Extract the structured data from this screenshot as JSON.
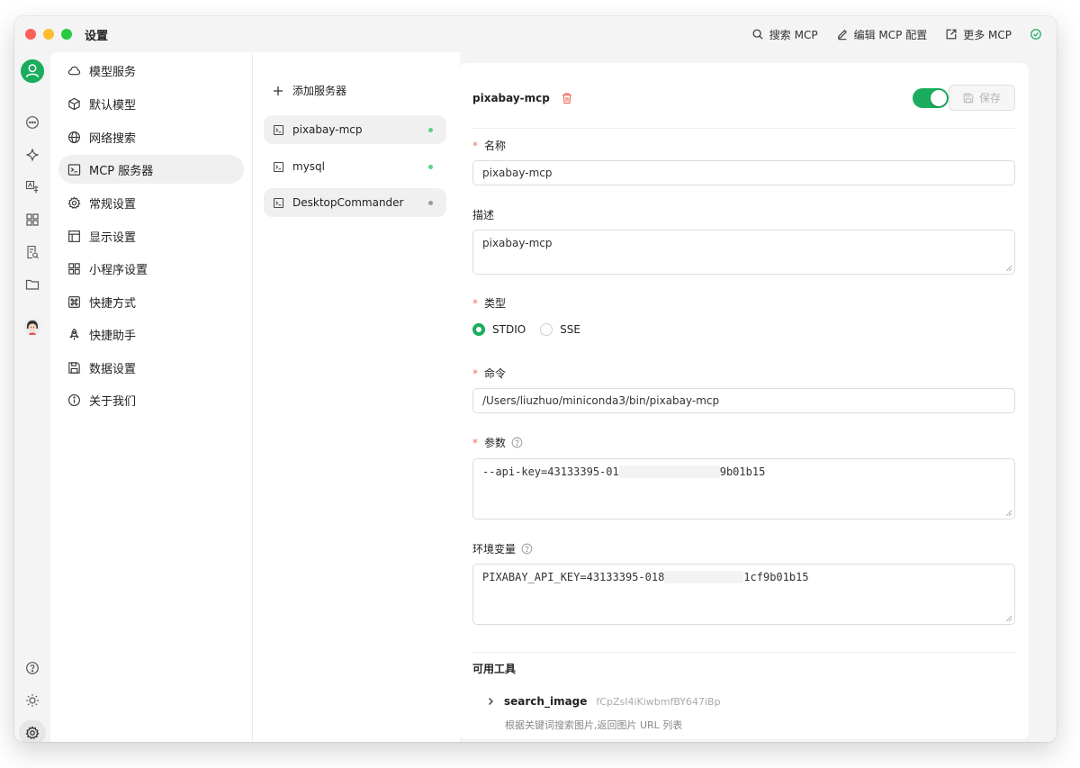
{
  "window": {
    "title": "设置"
  },
  "titlebar": {
    "actions": [
      {
        "label": "搜索 MCP",
        "icon": "search-icon"
      },
      {
        "label": "编辑 MCP 配置",
        "icon": "edit-icon"
      },
      {
        "label": "更多 MCP",
        "icon": "external-link-icon"
      }
    ]
  },
  "colors": {
    "accent": "#1aad5e",
    "danger": "#f07060",
    "traffic_red": "#fe5f57",
    "traffic_yellow": "#febc2e",
    "traffic_green": "#28c840",
    "status_active": "#5fcf8a",
    "status_inactive": "#9a9a9e"
  },
  "menu": {
    "items": [
      {
        "label": "模型服务",
        "icon": "cloud-icon"
      },
      {
        "label": "默认模型",
        "icon": "cube-icon"
      },
      {
        "label": "网络搜索",
        "icon": "globe-icon"
      },
      {
        "label": "MCP 服务器",
        "icon": "terminal-icon"
      },
      {
        "label": "常规设置",
        "icon": "gear-icon"
      },
      {
        "label": "显示设置",
        "icon": "layout-icon"
      },
      {
        "label": "小程序设置",
        "icon": "grid-icon"
      },
      {
        "label": "快捷方式",
        "icon": "command-icon"
      },
      {
        "label": "快捷助手",
        "icon": "rocket-icon"
      },
      {
        "label": "数据设置",
        "icon": "save-icon"
      },
      {
        "label": "关于我们",
        "icon": "info-icon"
      }
    ],
    "active_index": 3
  },
  "servers": {
    "add_label": "添加服务器",
    "items": [
      {
        "name": "pixabay-mcp",
        "active": true
      },
      {
        "name": "mysql",
        "active": true
      },
      {
        "name": "DesktopCommander",
        "active": false
      }
    ]
  },
  "detail": {
    "name": "pixabay-mcp",
    "enabled": true,
    "save_label": "保存",
    "fields": {
      "name_label": "名称",
      "name_value": "pixabay-mcp",
      "desc_label": "描述",
      "desc_value": "pixabay-mcp",
      "type_label": "类型",
      "type_options": [
        "STDIO",
        "SSE"
      ],
      "type_selected": "STDIO",
      "command_label": "命令",
      "command_value": "/Users/liuzhuo/miniconda3/bin/pixabay-mcp",
      "args_label": "参数",
      "args_prefix": "--api-key=43133395-01",
      "args_suffix": "9b01b15",
      "env_label": "环境变量",
      "env_prefix": "PIXABAY_API_KEY=43133395-018",
      "env_suffix": "1cf9b01b15"
    },
    "tools": {
      "title": "可用工具",
      "items": [
        {
          "name": "search_image",
          "id": "fCpZsI4iKiwbmfBY647iBp",
          "description": "根据关键词搜索图片,返回图片 URL 列表"
        }
      ]
    }
  }
}
